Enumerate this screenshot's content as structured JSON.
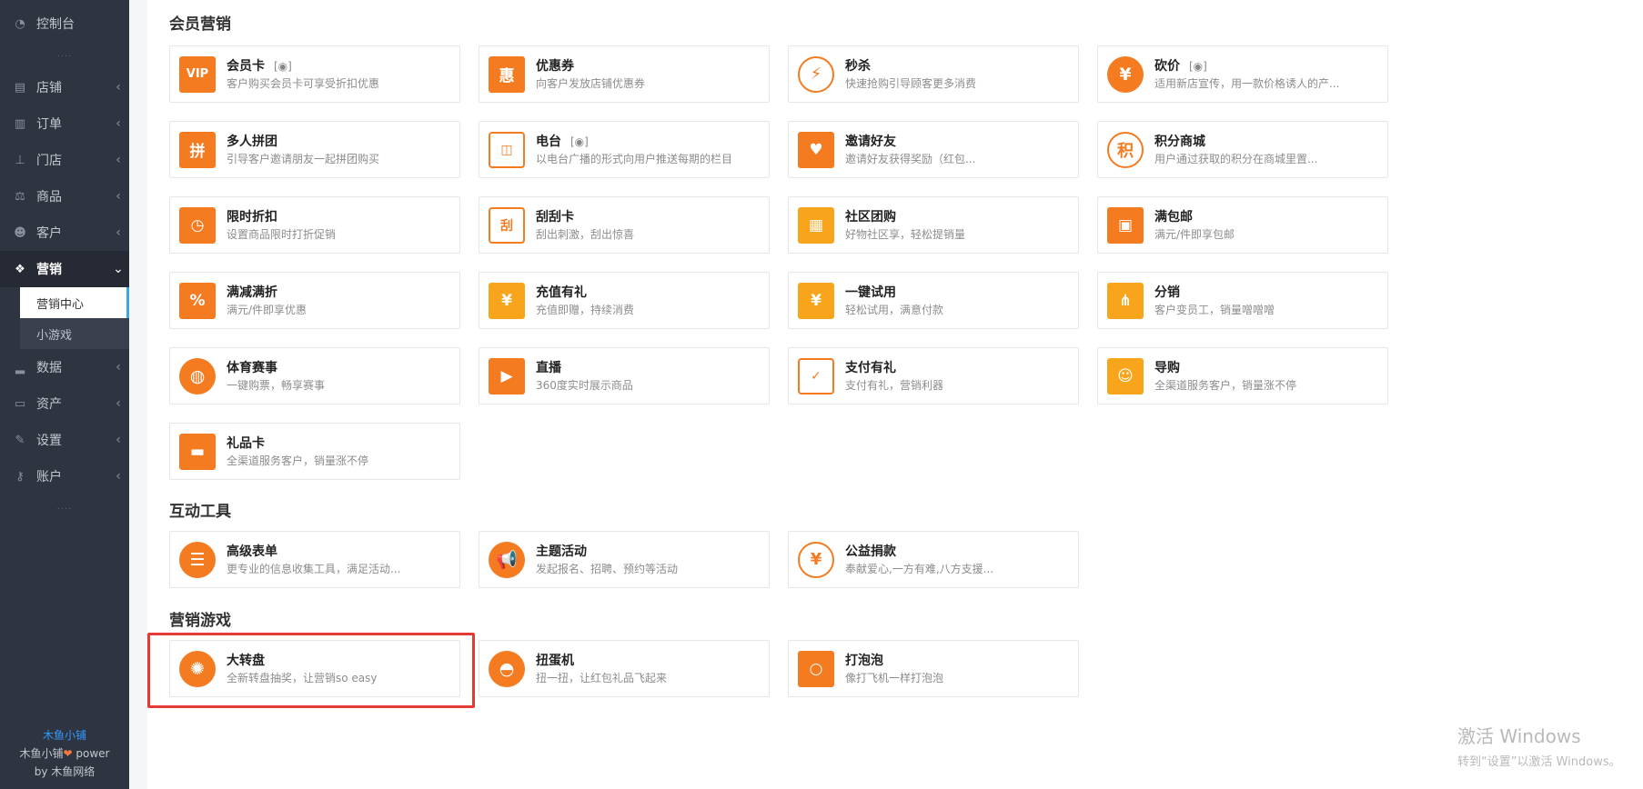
{
  "sidebar": {
    "top_item": {
      "label": "控制台",
      "icon": "dashboard-icon"
    },
    "dots": "....",
    "items": [
      {
        "label": "店铺",
        "icon": "shop-icon"
      },
      {
        "label": "订单",
        "icon": "order-icon"
      },
      {
        "label": "门店",
        "icon": "store-tree-icon"
      },
      {
        "label": "商品",
        "icon": "scale-icon"
      },
      {
        "label": "客户",
        "icon": "users-icon"
      },
      {
        "label": "营销",
        "icon": "gift-icon",
        "active": true
      },
      {
        "label": "数据",
        "icon": "bar-chart-icon"
      },
      {
        "label": "资产",
        "icon": "wallet-icon"
      },
      {
        "label": "设置",
        "icon": "wrench-icon"
      },
      {
        "label": "账户",
        "icon": "key-icon"
      }
    ],
    "sub_items": [
      {
        "label": "营销中心",
        "current": true
      },
      {
        "label": "小游戏",
        "current": false
      }
    ],
    "dots_bottom": "....",
    "brand": {
      "name": "木鱼小铺",
      "power_prefix": "木鱼小铺",
      "power_suffix": " power",
      "by": "by 木鱼网络"
    }
  },
  "sections": [
    {
      "title": "会员营销",
      "cards": [
        {
          "title": "会员卡",
          "desc": "客户购买会员卡可享受折扣优惠",
          "icon": "vip-card-icon",
          "glyph": "VIP",
          "style": "orange-sq",
          "eye": true
        },
        {
          "title": "优惠券",
          "desc": "向客户发放店铺优惠券",
          "icon": "coupon-icon",
          "glyph": "惠",
          "style": "orange-sq",
          "eye": false
        },
        {
          "title": "秒杀",
          "desc": "快速抢购引导顾客更多消费",
          "icon": "lightning-icon",
          "glyph": "⚡",
          "style": "outline",
          "eye": false
        },
        {
          "title": "砍价",
          "desc": "适用新店宣传，用一款价格诱人的产...",
          "icon": "bargain-icon",
          "glyph": "¥",
          "style": "orange-round",
          "eye": true
        },
        {
          "title": "多人拼团",
          "desc": "引导客户邀请朋友一起拼团购买",
          "icon": "group-buy-icon",
          "glyph": "拼",
          "style": "orange-sq",
          "eye": false
        },
        {
          "title": "电台",
          "desc": "以电台广播的形式向用户推送每期的栏目",
          "icon": "radio-icon",
          "glyph": "◫",
          "style": "outline-sq",
          "eye": true
        },
        {
          "title": "邀请好友",
          "desc": "邀请好友获得奖励（红包...",
          "icon": "invite-envelope-icon",
          "glyph": "♥",
          "style": "orange-sq",
          "eye": false
        },
        {
          "title": "积分商城",
          "desc": "用户通过获取的积分在商城里置...",
          "icon": "points-icon",
          "glyph": "积",
          "style": "outline",
          "eye": false
        },
        {
          "title": "限时折扣",
          "desc": "设置商品限时打折促销",
          "icon": "clock-icon",
          "glyph": "◷",
          "style": "orange-sq",
          "eye": false
        },
        {
          "title": "刮刮卡",
          "desc": "刮出刺激，刮出惊喜",
          "icon": "scratch-card-icon",
          "glyph": "刮",
          "style": "outline-sq",
          "eye": false
        },
        {
          "title": "社区团购",
          "desc": "好物社区享，轻松提销量",
          "icon": "building-icon",
          "glyph": "▦",
          "style": "yellow-sq",
          "eye": false
        },
        {
          "title": "满包邮",
          "desc": "满元/件即享包邮",
          "icon": "package-icon",
          "glyph": "▣",
          "style": "orange-sq",
          "eye": false
        },
        {
          "title": "满减满折",
          "desc": "满元/件即享优惠",
          "icon": "percent-icon",
          "glyph": "%",
          "style": "orange-sq",
          "eye": false
        },
        {
          "title": "充值有礼",
          "desc": "充值即赠，持续消费",
          "icon": "money-bag-icon",
          "glyph": "¥",
          "style": "yellow-sq",
          "eye": false
        },
        {
          "title": "一键试用",
          "desc": "轻松试用，满意付款",
          "icon": "trial-bag-icon",
          "glyph": "¥",
          "style": "yellow-sq",
          "eye": false
        },
        {
          "title": "分销",
          "desc": "客户变员工，销量噌噌噌",
          "icon": "distribution-icon",
          "glyph": "⋔",
          "style": "yellow-sq",
          "eye": false
        },
        {
          "title": "体育赛事",
          "desc": "一键购票，畅享赛事",
          "icon": "basketball-icon",
          "glyph": "◍",
          "style": "orange-round",
          "eye": false
        },
        {
          "title": "直播",
          "desc": "360度实时展示商品",
          "icon": "live-tv-icon",
          "glyph": "▶",
          "style": "orange-sq",
          "eye": false
        },
        {
          "title": "支付有礼",
          "desc": "支付有礼，营销利器",
          "icon": "payment-check-icon",
          "glyph": "✓",
          "style": "outline-sq",
          "eye": false
        },
        {
          "title": "导购",
          "desc": "全渠道服务客户，销量涨不停",
          "icon": "shopping-guide-icon",
          "glyph": "☺",
          "style": "yellow-sq",
          "eye": false
        },
        {
          "title": "礼品卡",
          "desc": "全渠道服务客户，销量涨不停",
          "icon": "gift-card-icon",
          "glyph": "▬",
          "style": "orange-sq",
          "eye": false
        }
      ]
    },
    {
      "title": "互动工具",
      "cards": [
        {
          "title": "高级表单",
          "desc": "更专业的信息收集工具，满足活动...",
          "icon": "form-icon",
          "glyph": "☰",
          "style": "orange-round",
          "eye": false
        },
        {
          "title": "主题活动",
          "desc": "发起报名、招聘、预约等活动",
          "icon": "megaphone-icon",
          "glyph": "📢",
          "style": "orange-round",
          "eye": false
        },
        {
          "title": "公益捐款",
          "desc": "奉献爱心,一方有难,八方支援...",
          "icon": "charity-hands-icon",
          "glyph": "¥",
          "style": "outline",
          "eye": false
        }
      ]
    },
    {
      "title": "营销游戏",
      "cards": [
        {
          "title": "大转盘",
          "desc": "全新转盘抽奖，让营销so easy",
          "icon": "wheel-icon",
          "glyph": "✺",
          "style": "orange-round",
          "eye": false
        },
        {
          "title": "扭蛋机",
          "desc": "扭一扭，让红包礼品飞起来",
          "icon": "capsule-icon",
          "glyph": "◓",
          "style": "orange-round",
          "eye": false
        },
        {
          "title": "打泡泡",
          "desc": "像打飞机一样打泡泡",
          "icon": "bubble-icon",
          "glyph": "○",
          "style": "orange-sq",
          "eye": false
        }
      ]
    }
  ],
  "watermark": {
    "line1": "激活 Windows",
    "line2": "转到“设置”以激活 Windows。"
  }
}
